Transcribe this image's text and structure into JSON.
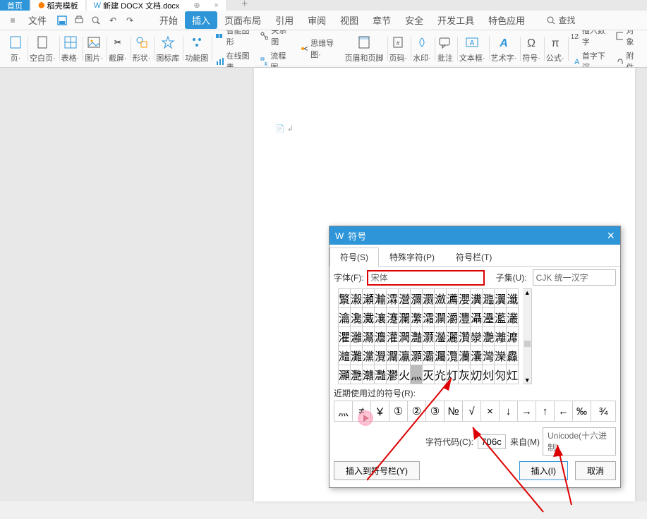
{
  "tabs": {
    "home": "首页",
    "template": "稻壳模板",
    "doc": "新建 DOCX 文档.docx"
  },
  "menu": {
    "file": "文件",
    "items": [
      "开始",
      "插入",
      "页面布局",
      "引用",
      "审阅",
      "视图",
      "章节",
      "安全",
      "开发工具",
      "特色应用"
    ],
    "search": "查找"
  },
  "ribbon": {
    "cover": "页·",
    "blank": "空白页·",
    "table": "表格·",
    "picture": "图片·",
    "screenshot": "截屏·",
    "shapes": "形状·",
    "icons": "图标库",
    "features": "功能图",
    "smart": "智能图形",
    "relation": "关系图",
    "onlinechart": "在线图表",
    "mindmap": "思维导图·",
    "flowchart": "流程图·",
    "header": "页眉和页脚",
    "pageno": "页码·",
    "watermark": "水印·",
    "comment": "批注",
    "textbox": "文本框·",
    "wordart": "艺术字·",
    "symbol": "符号·",
    "formula": "公式·",
    "insertnum": "插入数字",
    "firstcap": "首字下沉",
    "object": "对象",
    "attach": "附件"
  },
  "dialog": {
    "title": "符号",
    "tabs": {
      "symbol": "符号(S)",
      "special": "特殊字符(P)",
      "bar": "符号栏(T)"
    },
    "font_label": "字体(F):",
    "font_value": "宋体",
    "subset_label": "子集(U):",
    "subset_value": "CJK 统一汉字",
    "grid": [
      "瀪",
      "瀫",
      "瀬",
      "瀭",
      "瀮",
      "瀯",
      "瀰",
      "瀱",
      "瀲",
      "瀳",
      "瀴",
      "瀵",
      "瀶",
      "瀷",
      "瀸",
      "瀹",
      "瀺",
      "瀻",
      "瀼",
      "瀽",
      "瀾",
      "瀿",
      "灀",
      "灁",
      "灂",
      "灃",
      "灄",
      "灅",
      "灆",
      "灇",
      "灈",
      "灉",
      "灊",
      "灋",
      "灌",
      "灍",
      "灎",
      "灏",
      "灐",
      "灑",
      "灒",
      "灓",
      "灔",
      "灕",
      "灖",
      "灗",
      "灘",
      "灙",
      "灚",
      "灛",
      "灜",
      "灝",
      "灞",
      "灟",
      "灠",
      "灡",
      "灢",
      "灣",
      "灤",
      "灥",
      "灦",
      "灧",
      "灨",
      "灩",
      "灪",
      "火",
      "灬",
      "灭",
      "灮",
      "灯",
      "灰",
      "灱",
      "灲",
      "灳",
      "灴"
    ],
    "selected_index": 66,
    "recent_label": "近期使用过的符号(R):",
    "recent": [
      "灬",
      "≠",
      "￥",
      "①",
      "②",
      "③",
      "№",
      "√",
      "×",
      "↓",
      "→",
      "↑",
      "←",
      "‰",
      "¾"
    ],
    "code_label": "字符代码(C):",
    "code_value": "706c",
    "from_label": "来自(M)",
    "from_value": "Unicode(十六进制)",
    "insert_bar": "插入到符号栏(Y)",
    "insert": "插入(I)",
    "cancel": "取消"
  }
}
